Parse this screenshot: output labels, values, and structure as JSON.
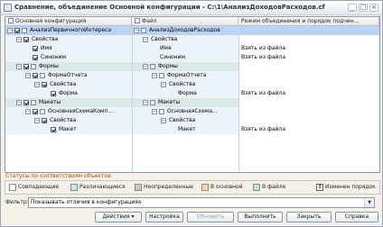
{
  "window": {
    "title": "Сравнение, объединение Основной конфигурации - C:\\1\\АнализДоходовРасходов.cf",
    "minimize_glyph": "_",
    "maximize_glyph": "□",
    "close_glyph": "×"
  },
  "tree": {
    "headers": [
      "Основная конфигурация",
      "Файл",
      "Режим объединения и порядок подчин..."
    ],
    "rows": [
      {
        "left": "АнализПервичногоИнтереса",
        "right": "АнализДоходовРасходов",
        "mode": "",
        "toggle": "−",
        "icon": "config-icon",
        "selected": true
      },
      {
        "left": "Свойства",
        "right": "Свойства",
        "mode": "",
        "toggle": "−",
        "icon": "",
        "selected": false
      },
      {
        "left": "Имя",
        "right": "Имя",
        "mode": "Взять из файла",
        "toggle": "",
        "icon": "",
        "selected": false
      },
      {
        "left": "Синоним",
        "right": "Синоним",
        "mode": "Взять из файла",
        "toggle": "",
        "icon": "",
        "selected": false
      },
      {
        "left": "Формы",
        "right": "Формы",
        "mode": "",
        "toggle": "−",
        "icon": "forms-icon",
        "selected": false
      },
      {
        "left": "ФормаОтчета",
        "right": "ФормаОтчета",
        "mode": "",
        "toggle": "−",
        "icon": "form-icon",
        "selected": false
      },
      {
        "left": "Свойства",
        "right": "Свойства",
        "mode": "",
        "toggle": "−",
        "icon": "",
        "selected": false
      },
      {
        "left": "Форма",
        "right": "Форма",
        "mode": "Взять из файла",
        "toggle": "",
        "icon": "",
        "selected": false
      },
      {
        "left": "Макеты",
        "right": "Макеты",
        "mode": "",
        "toggle": "−",
        "icon": "layouts-icon",
        "selected": false
      },
      {
        "left": "ОсновнаяСхемаКомп...",
        "right": "ОсновнаяСхема...",
        "mode": "",
        "toggle": "−",
        "icon": "layout-icon",
        "selected": false
      },
      {
        "left": "Свойства",
        "right": "Свойства",
        "mode": "",
        "toggle": "−",
        "icon": "",
        "selected": false
      },
      {
        "left": "Макет",
        "right": "Макет",
        "mode": "Взять из файла",
        "toggle": "",
        "icon": "",
        "selected": false
      }
    ]
  },
  "legend": {
    "title": "Статусы по соответствиям объектов",
    "items": [
      {
        "label": "Совпадающие",
        "color": "#ffffff"
      },
      {
        "label": "Различающиеся",
        "color": "#cfe3ee"
      },
      {
        "label": "Неопределенные",
        "color": "#c8c8c8"
      },
      {
        "label": "В основной",
        "color": "#f6d7a7"
      },
      {
        "label": "В файле",
        "color": "#c7e4b7"
      },
      {
        "label": "Изменен порядок",
        "color": "#ffffff"
      }
    ]
  },
  "filter": {
    "label": "Фильтр:",
    "value": "Показывать отличия в конфигурациях"
  },
  "buttons": {
    "actions": "Действия",
    "settings": "Настройка",
    "refresh": "Обновить",
    "execute": "Выполнить",
    "close": "Закрыть",
    "help": "Справка"
  }
}
